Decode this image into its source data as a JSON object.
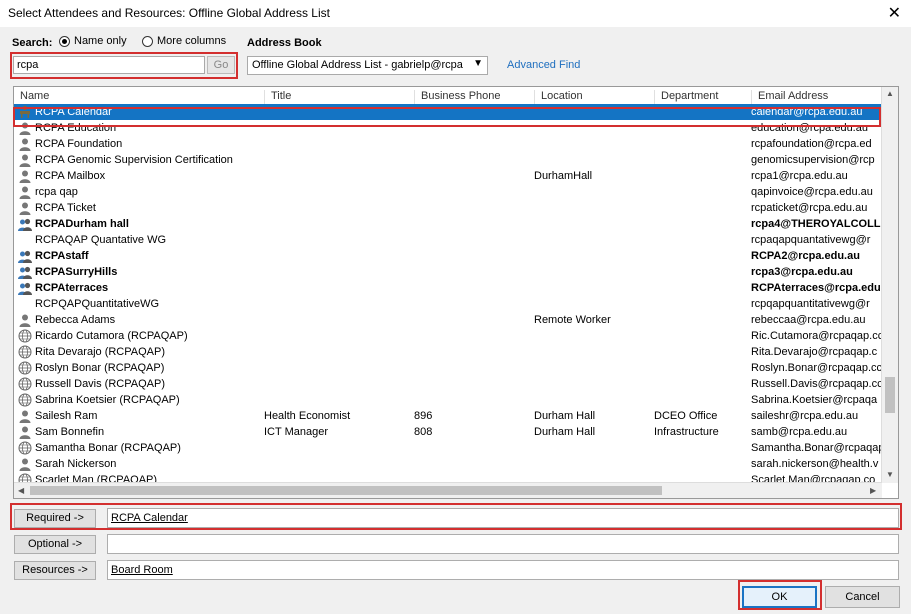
{
  "window": {
    "title": "Select Attendees and Resources: Offline Global Address List"
  },
  "search": {
    "label": "Search:",
    "options": [
      "Name only",
      "More columns"
    ],
    "selected": "Name only",
    "value": "rcpa",
    "go_label": "Go"
  },
  "address_book": {
    "label": "Address Book",
    "selected": "Offline Global Address List - gabrielp@rcpa",
    "advanced_find": "Advanced Find"
  },
  "columns": [
    "Name",
    "Title",
    "Business Phone",
    "Location",
    "Department",
    "Email Address"
  ],
  "contacts": [
    {
      "icon": "room-icon",
      "name": "RCPA Calendar",
      "title": "",
      "phone": "",
      "location": "",
      "department": "",
      "email": "calendar@rcpa.edu.au",
      "bold": false,
      "selected": true
    },
    {
      "icon": "user-icon",
      "name": "RCPA Education",
      "title": "",
      "phone": "",
      "location": "",
      "department": "",
      "email": "education@rcpa.edu.au",
      "bold": false
    },
    {
      "icon": "user-icon",
      "name": "RCPA Foundation",
      "title": "",
      "phone": "",
      "location": "",
      "department": "",
      "email": "rcpafoundation@rcpa.ed",
      "bold": false
    },
    {
      "icon": "user-icon",
      "name": "RCPA Genomic Supervision Certification",
      "title": "",
      "phone": "",
      "location": "",
      "department": "",
      "email": "genomicsupervision@rcp",
      "bold": false
    },
    {
      "icon": "user-icon",
      "name": "RCPA Mailbox",
      "title": "",
      "phone": "",
      "location": "DurhamHall",
      "department": "",
      "email": "rcpa1@rcpa.edu.au",
      "bold": false
    },
    {
      "icon": "user-icon",
      "name": "rcpa qap",
      "title": "",
      "phone": "",
      "location": "",
      "department": "",
      "email": "qapinvoice@rcpa.edu.au",
      "bold": false
    },
    {
      "icon": "user-icon",
      "name": "RCPA Ticket",
      "title": "",
      "phone": "",
      "location": "",
      "department": "",
      "email": "rcpaticket@rcpa.edu.au",
      "bold": false
    },
    {
      "icon": "group-icon",
      "name": "RCPADurham hall",
      "title": "",
      "phone": "",
      "location": "",
      "department": "",
      "email": "rcpa4@THEROYALCOLLEC",
      "bold": true
    },
    {
      "icon": "none",
      "name": "RCPAQAP Quantative WG",
      "title": "",
      "phone": "",
      "location": "",
      "department": "",
      "email": "rcpaqapquantativewg@r",
      "bold": false
    },
    {
      "icon": "group-icon",
      "name": "RCPAstaff",
      "title": "",
      "phone": "",
      "location": "",
      "department": "",
      "email": "RCPA2@rcpa.edu.au",
      "bold": true
    },
    {
      "icon": "group-icon",
      "name": "RCPASurryHills",
      "title": "",
      "phone": "",
      "location": "",
      "department": "",
      "email": "rcpa3@rcpa.edu.au",
      "bold": true
    },
    {
      "icon": "group-icon",
      "name": "RCPAterraces",
      "title": "",
      "phone": "",
      "location": "",
      "department": "",
      "email": "RCPAterraces@rcpa.edu.a",
      "bold": true
    },
    {
      "icon": "none",
      "name": "RCPQAPQuantitativeWG",
      "title": "",
      "phone": "",
      "location": "",
      "department": "",
      "email": "rcpqapquantitativewg@r",
      "bold": false
    },
    {
      "icon": "user-icon",
      "name": "Rebecca Adams",
      "title": "",
      "phone": "",
      "location": "Remote Worker",
      "department": "",
      "email": "rebeccaa@rcpa.edu.au",
      "bold": false
    },
    {
      "icon": "globe-icon",
      "name": "Ricardo Cutamora (RCPAQAP)",
      "title": "",
      "phone": "",
      "location": "",
      "department": "",
      "email": "Ric.Cutamora@rcpaqap.cc",
      "bold": false
    },
    {
      "icon": "globe-icon",
      "name": "Rita Devarajo (RCPAQAP)",
      "title": "",
      "phone": "",
      "location": "",
      "department": "",
      "email": "Rita.Devarajo@rcpaqap.c",
      "bold": false
    },
    {
      "icon": "globe-icon",
      "name": "Roslyn Bonar (RCPAQAP)",
      "title": "",
      "phone": "",
      "location": "",
      "department": "",
      "email": "Roslyn.Bonar@rcpaqap.cc",
      "bold": false
    },
    {
      "icon": "globe-icon",
      "name": "Russell Davis (RCPAQAP)",
      "title": "",
      "phone": "",
      "location": "",
      "department": "",
      "email": "Russell.Davis@rcpaqap.cc",
      "bold": false
    },
    {
      "icon": "globe-icon",
      "name": "Sabrina Koetsier (RCPAQAP)",
      "title": "",
      "phone": "",
      "location": "",
      "department": "",
      "email": "Sabrina.Koetsier@rcpaqa",
      "bold": false
    },
    {
      "icon": "user-icon",
      "name": "Sailesh Ram",
      "title": "Health Economist",
      "phone": "896",
      "location": "Durham Hall",
      "department": "DCEO Office",
      "email": "saileshr@rcpa.edu.au",
      "bold": false
    },
    {
      "icon": "user-icon",
      "name": "Sam Bonnefin",
      "title": "ICT Manager",
      "phone": "808",
      "location": "Durham Hall",
      "department": "Infrastructure",
      "email": "samb@rcpa.edu.au",
      "bold": false
    },
    {
      "icon": "globe-icon",
      "name": "Samantha Bonar (RCPAQAP)",
      "title": "",
      "phone": "",
      "location": "",
      "department": "",
      "email": "Samantha.Bonar@rcpaqap",
      "bold": false
    },
    {
      "icon": "user-icon",
      "name": "Sarah Nickerson",
      "title": "",
      "phone": "",
      "location": "",
      "department": "",
      "email": "sarah.nickerson@health.v",
      "bold": false
    },
    {
      "icon": "globe-icon",
      "name": "Scarlet Man (RCPAQAP)",
      "title": "",
      "phone": "",
      "location": "",
      "department": "",
      "email": "Scarlet.Man@rcpaqap.co",
      "bold": false
    }
  ],
  "recipients": {
    "required_label": "Required ->",
    "required_value": "RCPA Calendar",
    "optional_label": "Optional ->",
    "optional_value": "",
    "resources_label": "Resources ->",
    "resources_value": "Board Room"
  },
  "buttons": {
    "ok": "OK",
    "cancel": "Cancel"
  },
  "colors": {
    "selection": "#1474c4",
    "highlight": "#d32f2f",
    "link": "#1f6fbf"
  }
}
